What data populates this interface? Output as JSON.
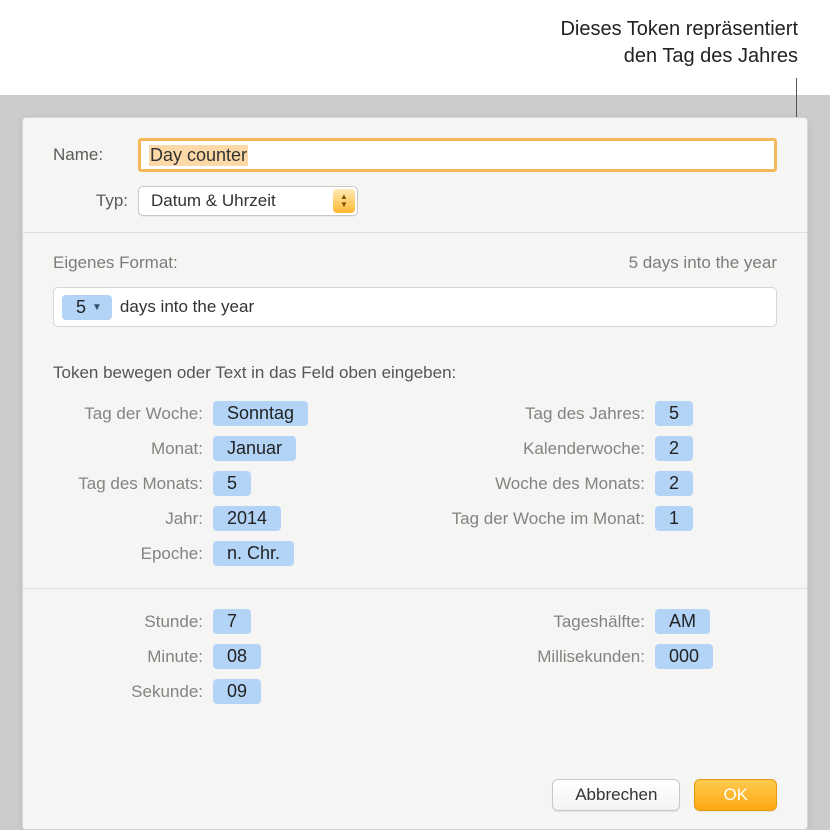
{
  "annotation": {
    "line1": "Dieses Token repräsentiert",
    "line2": "den Tag des Jahres"
  },
  "header": {
    "name_label": "Name:",
    "name_value": "Day counter",
    "type_label": "Typ:",
    "type_value": "Datum & Uhrzeit"
  },
  "format": {
    "label": "Eigenes Format:",
    "preview": "5 days into the year",
    "token_value": "5",
    "trailing_text": " days into the year"
  },
  "instruction": "Token bewegen oder Text in das Feld oben eingeben:",
  "tokens_left": [
    {
      "label": "Tag der Woche:",
      "value": "Sonntag"
    },
    {
      "label": "Monat:",
      "value": "Januar"
    },
    {
      "label": "Tag des Monats:",
      "value": "5"
    },
    {
      "label": "Jahr:",
      "value": "2014"
    },
    {
      "label": "Epoche:",
      "value": "n. Chr."
    }
  ],
  "tokens_right": [
    {
      "label": "Tag des Jahres:",
      "value": "5"
    },
    {
      "label": "Kalenderwoche:",
      "value": "2"
    },
    {
      "label": "Woche des Monats:",
      "value": "2"
    },
    {
      "label": "Tag der Woche im Monat:",
      "value": "1"
    }
  ],
  "time_left": [
    {
      "label": "Stunde:",
      "value": "7"
    },
    {
      "label": "Minute:",
      "value": "08"
    },
    {
      "label": "Sekunde:",
      "value": "09"
    }
  ],
  "time_right": [
    {
      "label": "Tageshälfte:",
      "value": "AM"
    },
    {
      "label": "Millisekunden:",
      "value": "000"
    }
  ],
  "buttons": {
    "cancel": "Abbrechen",
    "ok": "OK"
  }
}
